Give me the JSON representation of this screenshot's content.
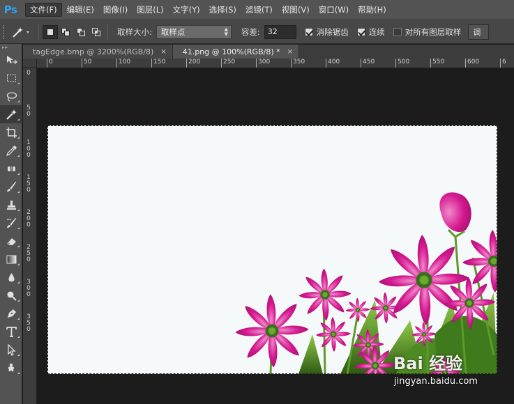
{
  "app": {
    "logo": "Ps"
  },
  "menu": [
    "文件(F)",
    "编辑(E)",
    "图像(I)",
    "图层(L)",
    "文字(Y)",
    "选择(S)",
    "滤镜(T)",
    "视图(V)",
    "窗口(W)",
    "帮助(H)"
  ],
  "options": {
    "sample_size_label": "取样大小:",
    "sample_size_value": "取样点",
    "tolerance_label": "容差:",
    "tolerance_value": "32",
    "antialias_label": "消除锯齿",
    "antialias_checked": true,
    "contiguous_label": "连续",
    "contiguous_checked": true,
    "all_layers_label": "对所有图层取样",
    "all_layers_checked": false,
    "refine_button": "调"
  },
  "tabs": [
    {
      "label": "tagEdge.bmp @ 3200%(RGB/8)",
      "close": "×",
      "active": false
    },
    {
      "label": "41.png @ 100%(RGB/8) *",
      "close": "×",
      "active": true
    }
  ],
  "ruler": {
    "h_labels": [
      "0",
      "50",
      "100",
      "150",
      "200",
      "250",
      "300",
      "350",
      "400",
      "450",
      "500",
      "550",
      "600",
      "6"
    ],
    "v_labels": [
      "0",
      "50",
      "100",
      "150",
      "200",
      "250",
      "300",
      "350"
    ]
  },
  "tools": [
    "move-icon",
    "marquee-icon",
    "lasso-icon",
    "magic-wand-icon",
    "crop-icon",
    "eyedropper-icon",
    "healing-brush-icon",
    "brush-icon",
    "stamp-icon",
    "history-brush-icon",
    "eraser-icon",
    "gradient-icon",
    "blur-icon",
    "dodge-icon",
    "pen-icon",
    "type-icon",
    "path-select-icon",
    "shape-icon"
  ],
  "colors": {
    "petal": "#d4198f",
    "leaf": "#5a9a2a",
    "canvas": "#f5f9fa"
  },
  "watermark": {
    "logo": "Bai 经验",
    "url": "jingyan.baidu.com"
  }
}
